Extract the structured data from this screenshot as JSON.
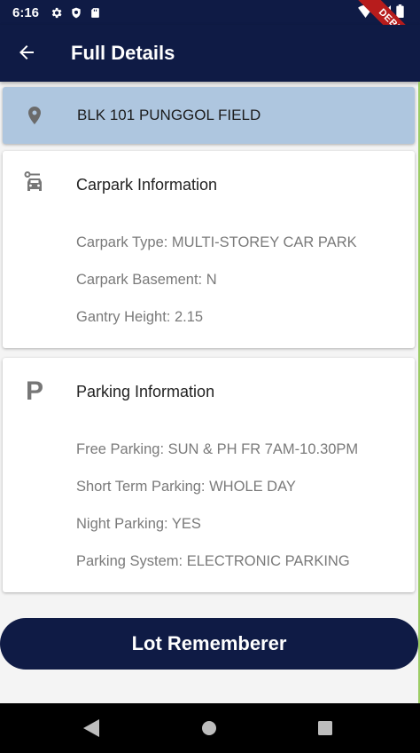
{
  "status_bar": {
    "time": "6:16",
    "debug_banner": "DEBUG"
  },
  "app_bar": {
    "title": "Full Details"
  },
  "location": {
    "name": "BLK 101 PUNGGOL FIELD"
  },
  "carpark": {
    "heading": "Carpark Information",
    "lines": [
      "Carpark Type: MULTI-STOREY CAR PARK",
      "Carpark Basement: N",
      "Gantry Height: 2.15"
    ]
  },
  "parking": {
    "icon_letter": "P",
    "heading": "Parking Information",
    "lines": [
      "Free Parking: SUN & PH FR 7AM-10.30PM",
      "Short Term Parking: WHOLE DAY",
      "Night Parking: YES",
      "Parking System: ELECTRONIC PARKING"
    ]
  },
  "action": {
    "button_label": "Lot Rememberer"
  },
  "colors": {
    "primary": "#0f1b45",
    "location_card": "#aec6df",
    "debug": "#b71c1c"
  }
}
